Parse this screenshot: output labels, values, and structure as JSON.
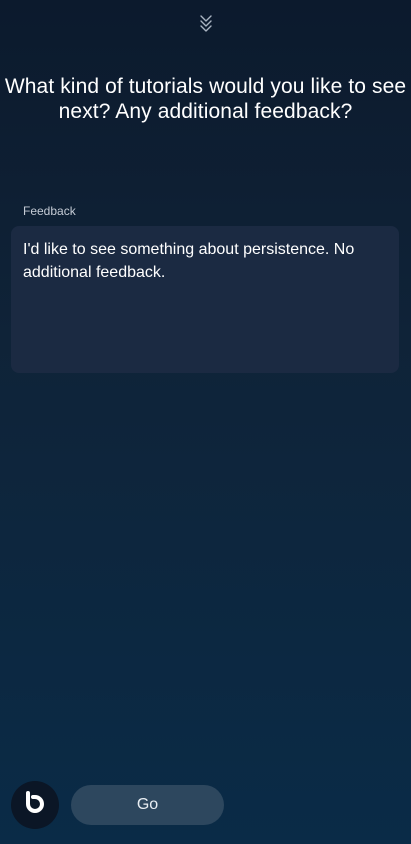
{
  "header": {
    "collapse_icon": "double-chevron-down-icon"
  },
  "question": {
    "text": "What kind of tutorials would you like to see next? Any additional feedback?"
  },
  "feedback": {
    "label": "Feedback",
    "value": "I'd like to see something about persistence. No additional feedback."
  },
  "footer": {
    "assistant_icon": "bixby-logo-icon",
    "go_label": "Go"
  },
  "colors": {
    "background_top": "#0c1a2d",
    "background_bottom": "#0a2b47",
    "input_background": "#1b2a42",
    "go_button": "#2d475e"
  }
}
